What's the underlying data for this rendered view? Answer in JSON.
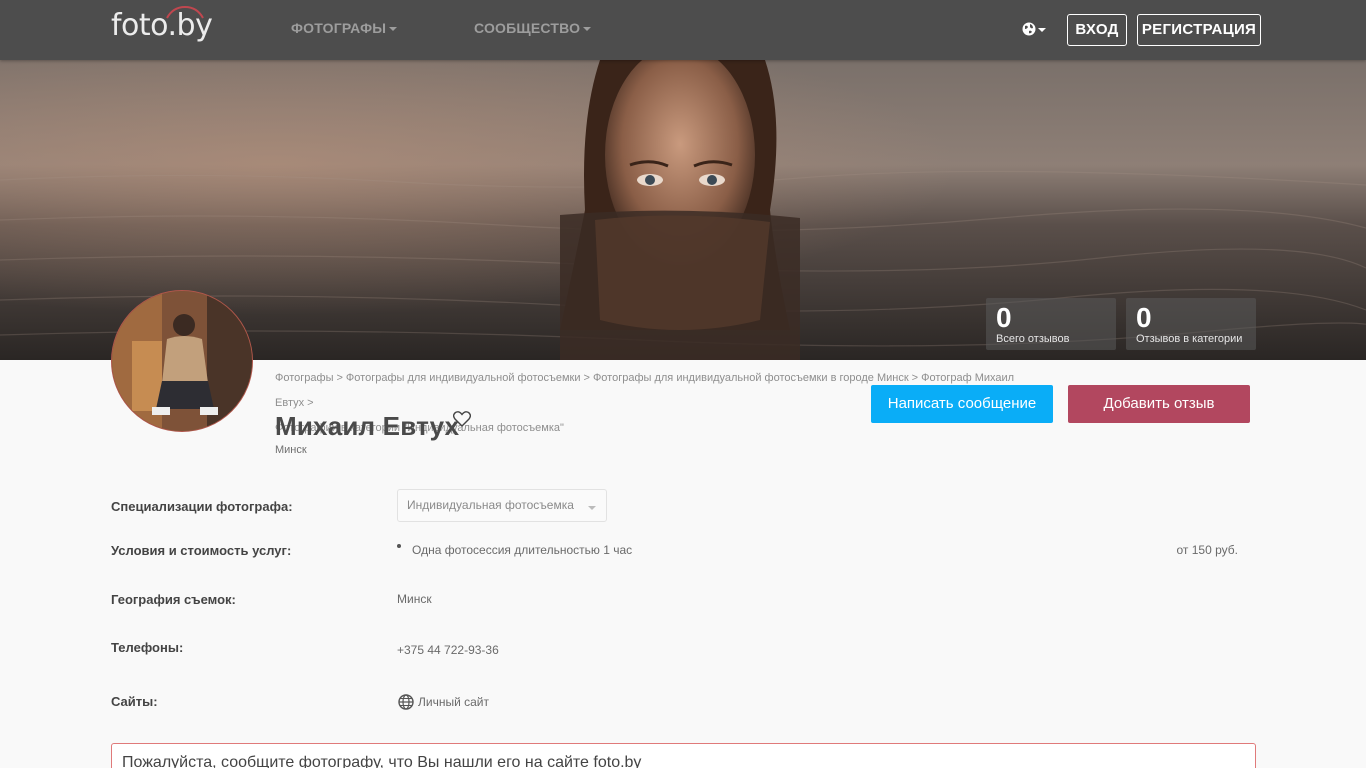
{
  "header": {
    "logo": "foto.by",
    "nav": [
      {
        "label": "ФОТОГРАФЫ"
      },
      {
        "label": "СООБЩЕСТВО"
      }
    ],
    "language_icon": "globe-icon",
    "login_label": "ВХОД",
    "register_label": "РЕГИСТРАЦИЯ"
  },
  "hero": {
    "stats": [
      {
        "value": "0",
        "label": "Всего отзывов"
      },
      {
        "value": "0",
        "label": "Отзывов в категории"
      }
    ]
  },
  "breadcrumb": {
    "items": [
      "Фотографы",
      "Фотографы для индивидуальной фотосъемки",
      "Фотографы для индивидуальной фотосъемки в городе Минск",
      "Фотограф Михаил Евтух",
      "Фотографии в категории \"Индивидуальная фотосъемка\""
    ],
    "separator": ">"
  },
  "profile": {
    "name": "Михаил Евтух",
    "city": "Минск",
    "favorite_icon": "heart-icon",
    "message_button": "Написать сообщение",
    "review_button": "Добавить отзыв"
  },
  "details": {
    "specializations_label": "Специализации фотографа:",
    "specialization_selected": "Индивидуальная фотосъемка",
    "conditions_label": "Условия и стоимость услуг:",
    "service_name": "Одна фотосессия длительностью 1 час",
    "service_price": "от 150 руб.",
    "geography_label": "География съемок:",
    "geography_value": "Минск",
    "phones_label": "Телефоны:",
    "phone_value": "+375 44 722-93-36",
    "sites_label": "Сайты:",
    "site_value": "Личный сайт"
  },
  "notice": {
    "text": "Пожалуйста, сообщите фотографу, что Вы нашли его на сайте foto.by"
  },
  "colors": {
    "header_bg": "#4d4d4d",
    "message_button": "#0aadf7",
    "review_button": "#b2475f",
    "notice_border": "#e07a7a"
  }
}
